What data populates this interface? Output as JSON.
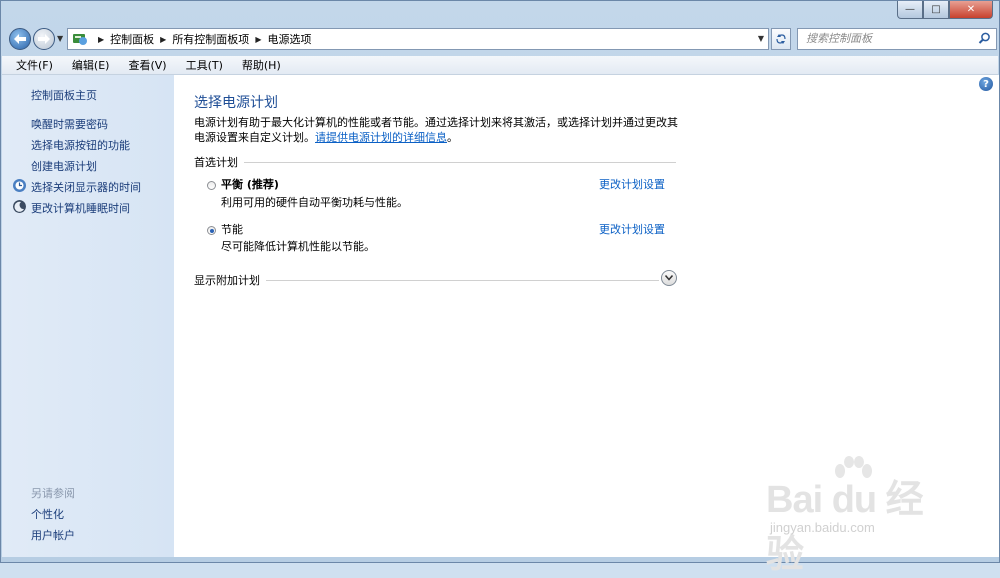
{
  "window": {
    "min_glyph": "—",
    "max_glyph": "□",
    "close_glyph": "✕"
  },
  "address": {
    "crumbs": [
      "控制面板",
      "所有控制面板项",
      "电源选项"
    ],
    "search_placeholder": "搜索控制面板"
  },
  "menu": [
    "文件(F)",
    "编辑(E)",
    "查看(V)",
    "工具(T)",
    "帮助(H)"
  ],
  "sidebar": {
    "home": "控制面板主页",
    "links": [
      "唤醒时需要密码",
      "选择电源按钮的功能",
      "创建电源计划",
      "选择关闭显示器的时间",
      "更改计算机睡眠时间"
    ],
    "see_also_title": "另请参阅",
    "see_also": [
      "个性化",
      "用户帐户"
    ]
  },
  "main": {
    "title": "选择电源计划",
    "description": "电源计划有助于最大化计算机的性能或者节能。通过选择计划来将其激活，或选择计划并通过更改其电源设置来自定义计划。",
    "info_link": "请提供电源计划的详细信息",
    "info_suffix": "。",
    "preferred_label": "首选计划",
    "plans": [
      {
        "name": "平衡 (推荐)",
        "desc": "利用可用的硬件自动平衡功耗与性能。",
        "link": "更改计划设置",
        "selected": false
      },
      {
        "name": "节能",
        "desc": "尽可能降低计算机性能以节能。",
        "link": "更改计划设置",
        "selected": true
      }
    ],
    "additional_label": "显示附加计划"
  },
  "help_glyph": "?",
  "watermark": {
    "main": "Bai du 经验",
    "sub": "jingyan.baidu.com"
  }
}
